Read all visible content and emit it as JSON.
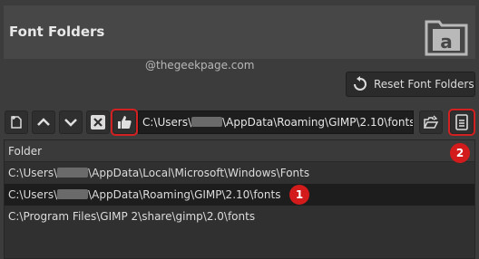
{
  "dialog": {
    "title": "Font Folders",
    "watermark": "@thegeekpage.com",
    "reset_button_label": "Reset Font Folders"
  },
  "toolbar": {
    "path_value_prefix": "C:\\Users\\",
    "path_value_suffix": "\\AppData\\Roaming\\GIMP\\2.10\\fonts"
  },
  "list": {
    "column_header": "Folder",
    "rows": [
      {
        "prefix": "C:\\Users\\",
        "suffix": "\\AppData\\Local\\Microsoft\\Windows\\Fonts",
        "redacted": true
      },
      {
        "prefix": "C:\\Users\\",
        "suffix": "\\AppData\\Roaming\\GIMP\\2.10\\fonts",
        "redacted": true
      },
      {
        "prefix": "C:\\Program Files\\GIMP 2\\share\\gimp\\2.0\\fonts",
        "suffix": "",
        "redacted": false
      }
    ]
  },
  "annotations": {
    "badge1": "1",
    "badge2": "2"
  },
  "colors": {
    "highlight": "#d32020",
    "badge": "#d31b1b"
  }
}
